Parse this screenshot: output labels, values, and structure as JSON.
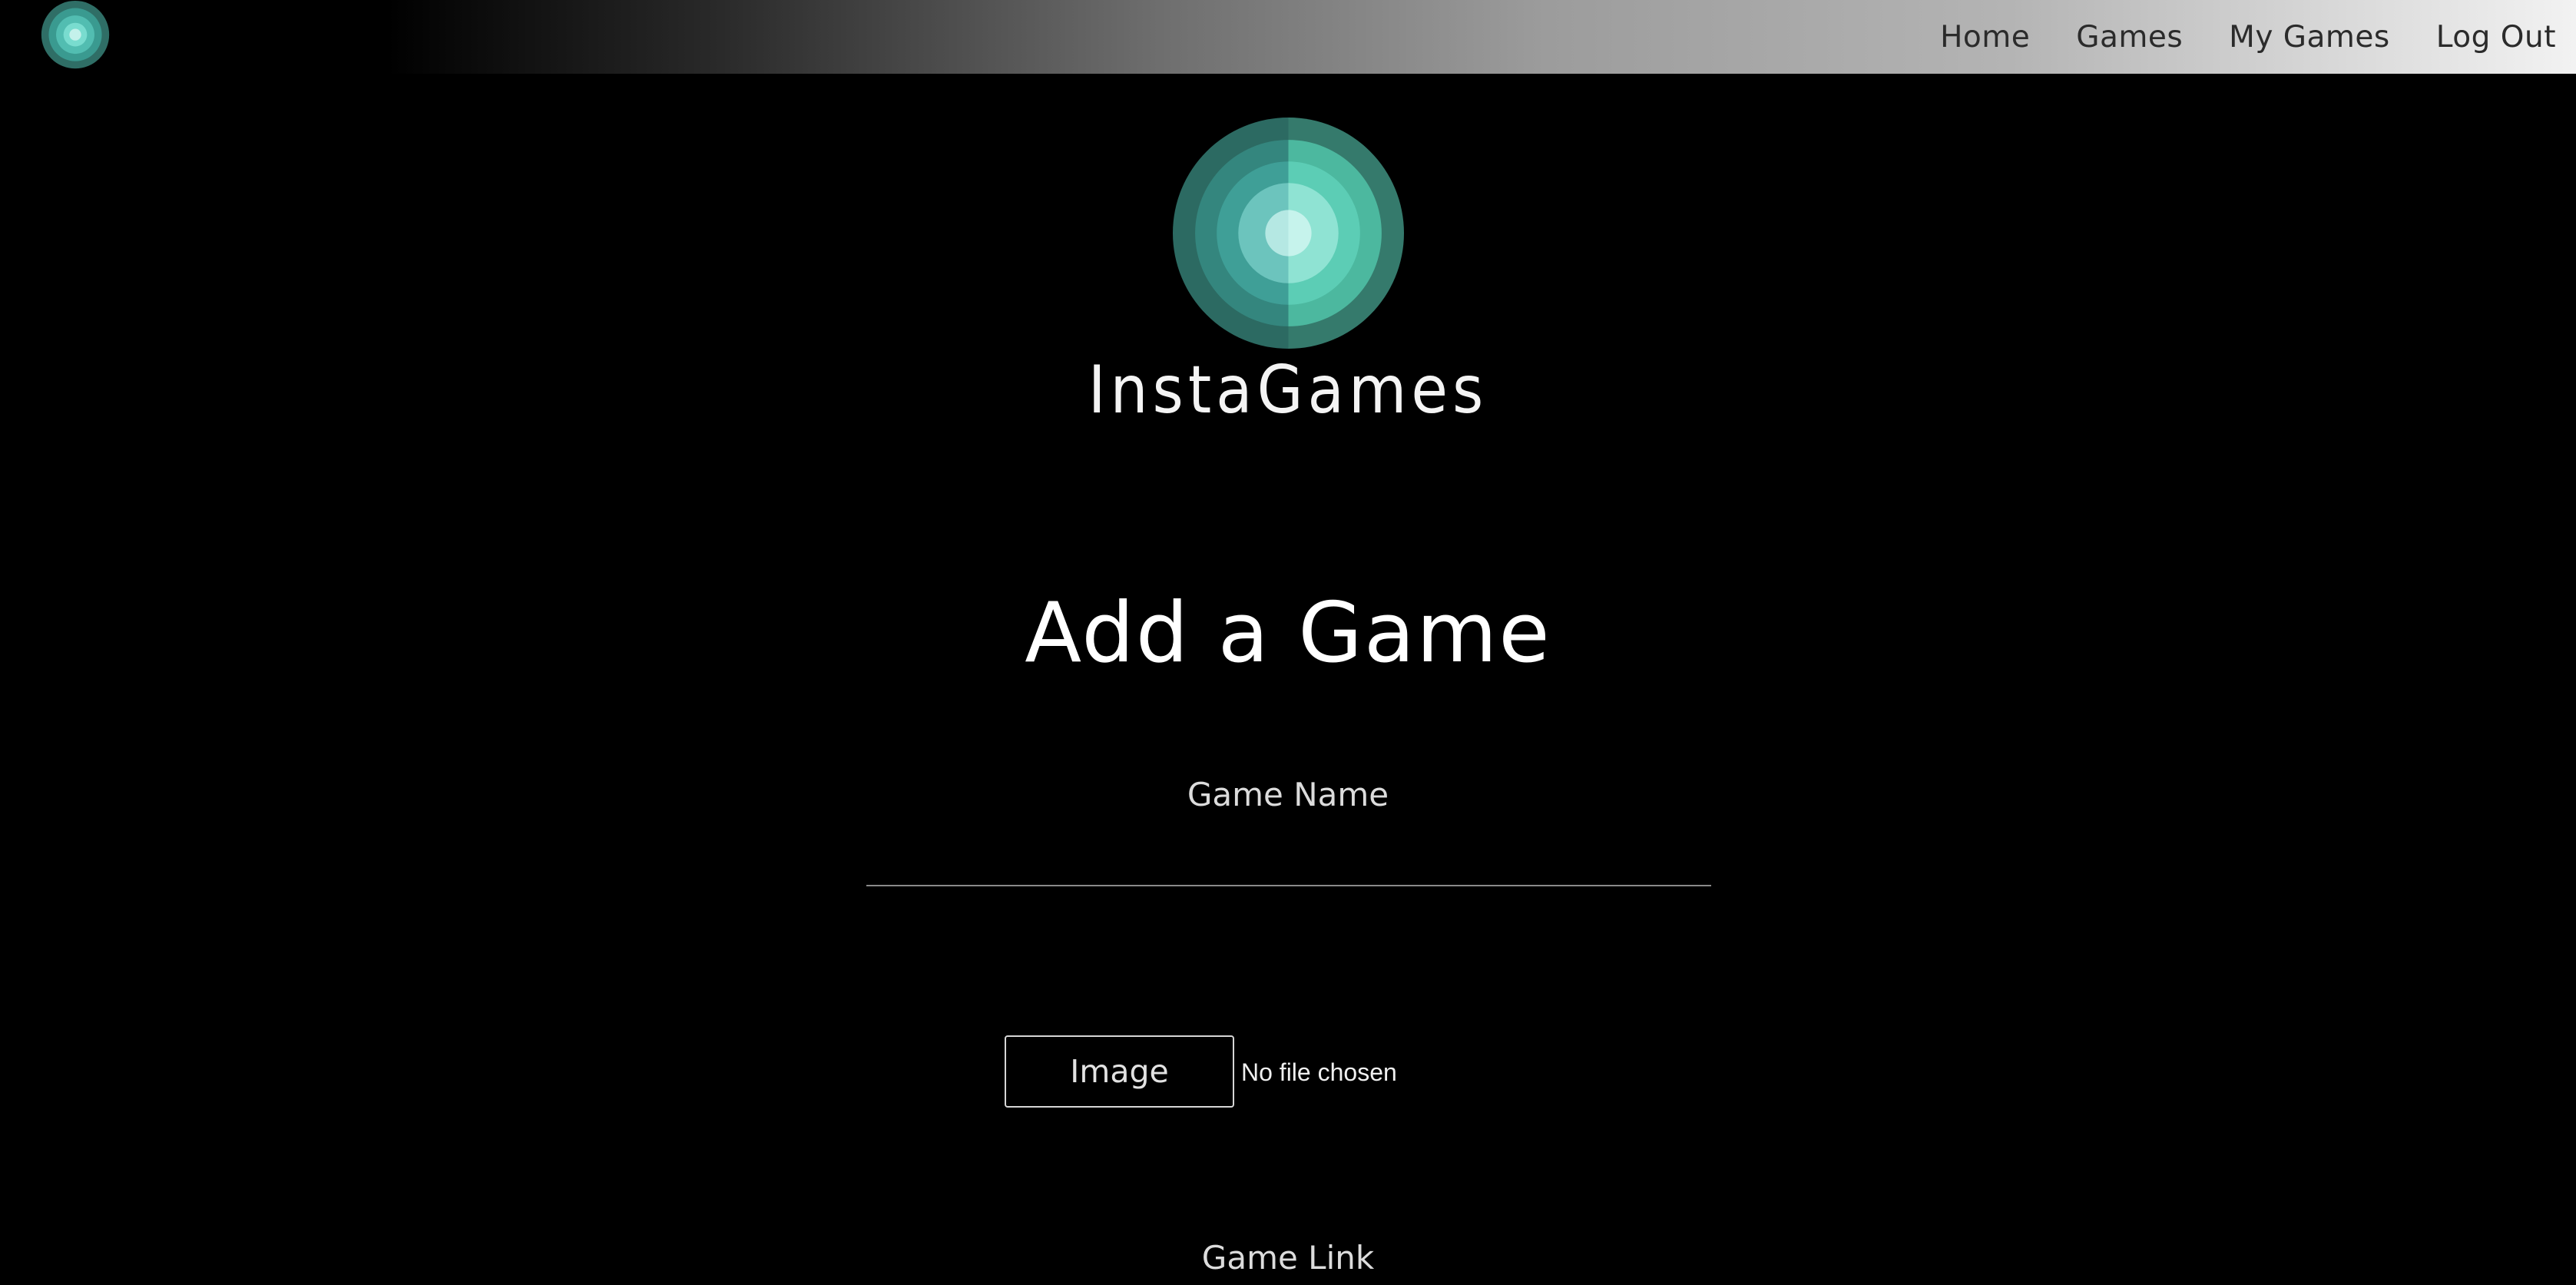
{
  "nav": {
    "logo_icon": "concentric-circles-logo-icon",
    "links": [
      "Home",
      "Games",
      "My Games",
      "Log Out"
    ]
  },
  "brand": {
    "logo_icon": "concentric-circles-logo-icon",
    "name": "InstaGames"
  },
  "form": {
    "title": "Add a Game",
    "game_name_label": "Game Name",
    "game_name_value": "",
    "image_button_label": "Image",
    "file_status": "No file chosen",
    "game_link_label": "Game Link"
  },
  "colors": {
    "background": "#000000",
    "logo_outer": "#2f6e66",
    "logo_mid": "#3ea39b",
    "logo_inner": "#5fcfc0",
    "logo_core": "#b8ece6"
  }
}
